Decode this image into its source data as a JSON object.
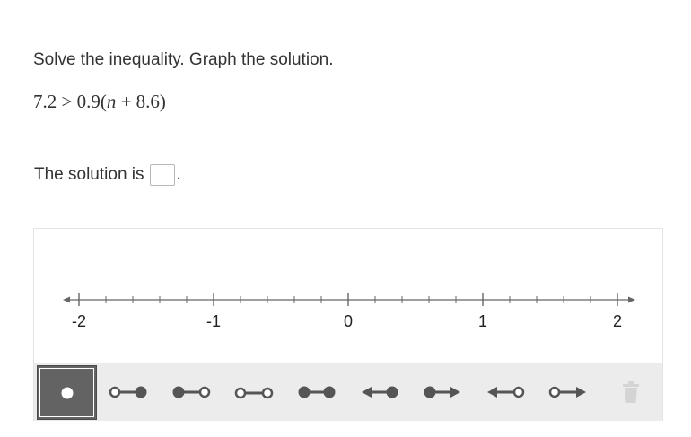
{
  "prompt": "Solve the inequality. Graph the solution.",
  "equation": {
    "left": "7.2 > 0.9(",
    "variable": "n",
    "right": " + 8.6)"
  },
  "answer": {
    "prefix": "The solution is",
    "value": "",
    "suffix": "."
  },
  "number_line": {
    "min": -2,
    "max": 2,
    "major_step": 1,
    "minor_step": 0.2,
    "labels": [
      "-2",
      "-1",
      "0",
      "1",
      "2"
    ]
  },
  "toolbar": {
    "tools": [
      {
        "name": "point-tool",
        "icon": "closed-point-icon",
        "selected": true
      },
      {
        "name": "segment-open-closed-tool",
        "icon": "open-closed-segment-icon"
      },
      {
        "name": "segment-closed-open-tool",
        "icon": "closed-open-segment-icon"
      },
      {
        "name": "segment-open-open-tool",
        "icon": "open-open-segment-icon"
      },
      {
        "name": "segment-closed-closed-tool",
        "icon": "closed-closed-segment-icon"
      },
      {
        "name": "ray-left-closed-tool",
        "icon": "left-ray-closed-icon"
      },
      {
        "name": "ray-right-closed-tool",
        "icon": "right-ray-closed-icon"
      },
      {
        "name": "ray-left-open-tool",
        "icon": "left-ray-open-icon"
      },
      {
        "name": "ray-right-open-tool",
        "icon": "right-ray-open-icon"
      },
      {
        "name": "delete-tool",
        "icon": "trash-icon"
      }
    ]
  },
  "colors": {
    "text": "#333333",
    "toolbar_bg": "#ececec",
    "selected_tool_bg": "#636363",
    "icon": "#555555",
    "trash_disabled": "#d4d4d4"
  }
}
